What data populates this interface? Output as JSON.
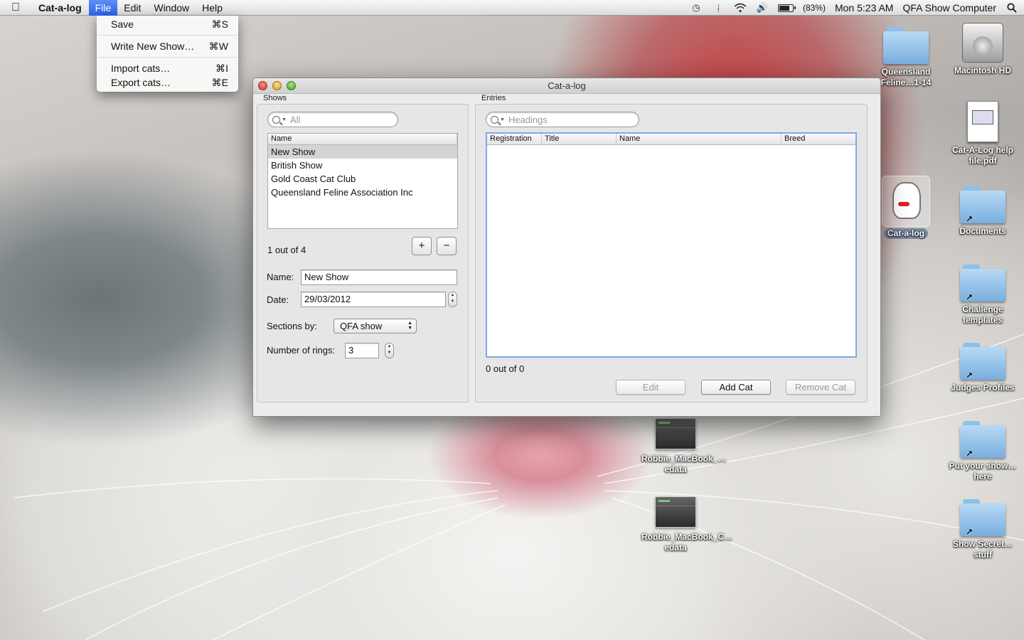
{
  "menubar": {
    "app_name": "Cat-a-log",
    "menus": [
      "File",
      "Edit",
      "Window",
      "Help"
    ],
    "status": {
      "battery": "(83%)",
      "battery_level": 0.83,
      "clock": "Mon 5:23 AM",
      "user": "QFA Show Computer"
    }
  },
  "file_menu": {
    "items": [
      {
        "label": "Save",
        "shortcut": "⌘S"
      },
      {
        "label": "Write New Show…",
        "shortcut": "⌘W"
      },
      {
        "label": "Import cats…",
        "shortcut": "⌘I"
      },
      {
        "label": "Export cats…",
        "shortcut": "⌘E"
      }
    ]
  },
  "window": {
    "title": "Cat-a-log",
    "shows": {
      "section_label": "Shows",
      "search_placeholder": "All",
      "column_header": "Name",
      "rows": [
        "New Show",
        "British Show",
        "Gold Coast Cat Club",
        "Queensland Feline Association Inc"
      ],
      "count_text": "1 out of 4",
      "add_label": "+",
      "remove_label": "−",
      "name_label": "Name:",
      "name_value": "New Show",
      "date_label": "Date:",
      "date_value": "29/03/2012",
      "sections_label": "Sections by:",
      "sections_value": "QFA show",
      "rings_label": "Number of rings:",
      "rings_value": "3"
    },
    "entries": {
      "section_label": "Entries",
      "search_placeholder": "Headings",
      "columns": [
        "Registration",
        "Title",
        "Name",
        "Breed"
      ],
      "count_text": "0 out of 0",
      "edit_label": "Edit",
      "add_cat_label": "Add Cat",
      "remove_cat_label": "Remove Cat"
    }
  },
  "desktop_icons": {
    "queensland": "Queensland Feline…1-14",
    "macintosh_hd": "Macintosh HD",
    "help_pdf": "Cat-A-Log help file.pdf",
    "catalog_app": "Cat-a-log",
    "documents": "Documents",
    "challenge": "Challenge templates",
    "judges": "Judges Profiles",
    "put_show": "Put your show…here",
    "show_secret": "Show Secret…stuff",
    "robbie1": "Robbie_MacBook_…edata",
    "robbie2": "Robbie_MacBook_C…edata"
  }
}
